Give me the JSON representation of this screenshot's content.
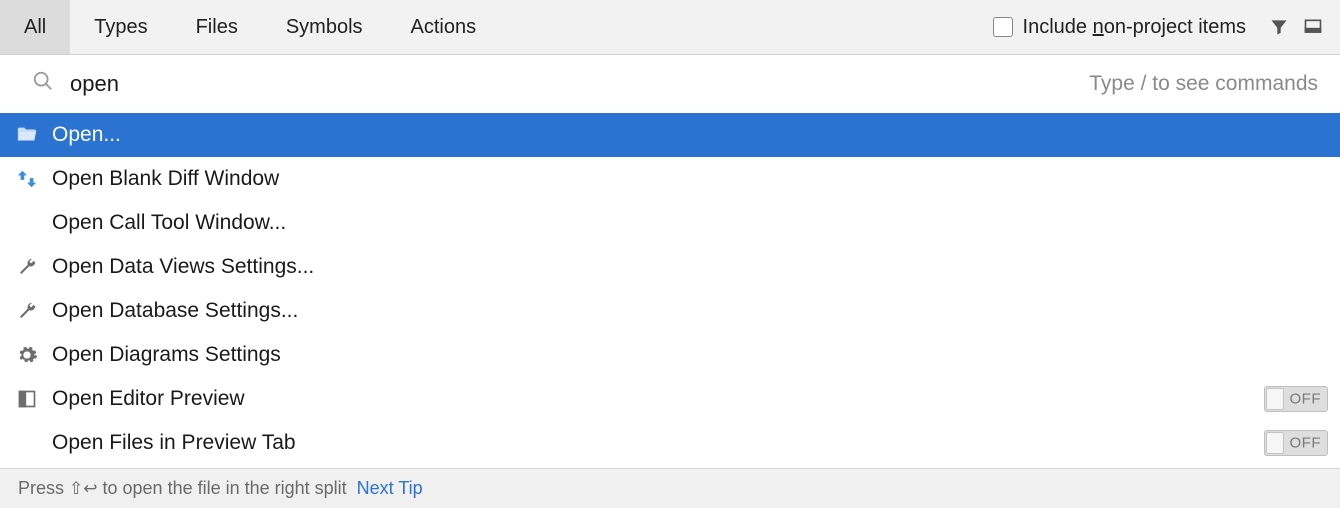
{
  "tabs": {
    "items": [
      {
        "label": "All",
        "active": true
      },
      {
        "label": "Types",
        "active": false
      },
      {
        "label": "Files",
        "active": false
      },
      {
        "label": "Symbols",
        "active": false
      },
      {
        "label": "Actions",
        "active": false
      }
    ]
  },
  "checkbox": {
    "prefix": "Include ",
    "underlined": "n",
    "suffix": "on-project items",
    "checked": false
  },
  "search": {
    "value": "open",
    "hint": "Type / to see commands"
  },
  "results": [
    {
      "icon": "folder-open-icon",
      "label": "Open...",
      "selected": true,
      "toggle": null
    },
    {
      "icon": "diff-icon",
      "label": "Open Blank Diff Window",
      "selected": false,
      "toggle": null
    },
    {
      "icon": "",
      "label": "Open Call Tool Window...",
      "selected": false,
      "toggle": null
    },
    {
      "icon": "wrench-icon",
      "label": "Open Data Views Settings...",
      "selected": false,
      "toggle": null
    },
    {
      "icon": "wrench-icon",
      "label": "Open Database Settings...",
      "selected": false,
      "toggle": null
    },
    {
      "icon": "gear-icon",
      "label": "Open Diagrams Settings",
      "selected": false,
      "toggle": null
    },
    {
      "icon": "preview-icon",
      "label": "Open Editor Preview",
      "selected": false,
      "toggle": "OFF"
    },
    {
      "icon": "",
      "label": "Open Files in Preview Tab",
      "selected": false,
      "toggle": "OFF"
    }
  ],
  "footer": {
    "text_prefix": "Press ",
    "shortcut": "⇧↩",
    "text_suffix": " to open the file in the right split",
    "next_tip": "Next Tip"
  }
}
